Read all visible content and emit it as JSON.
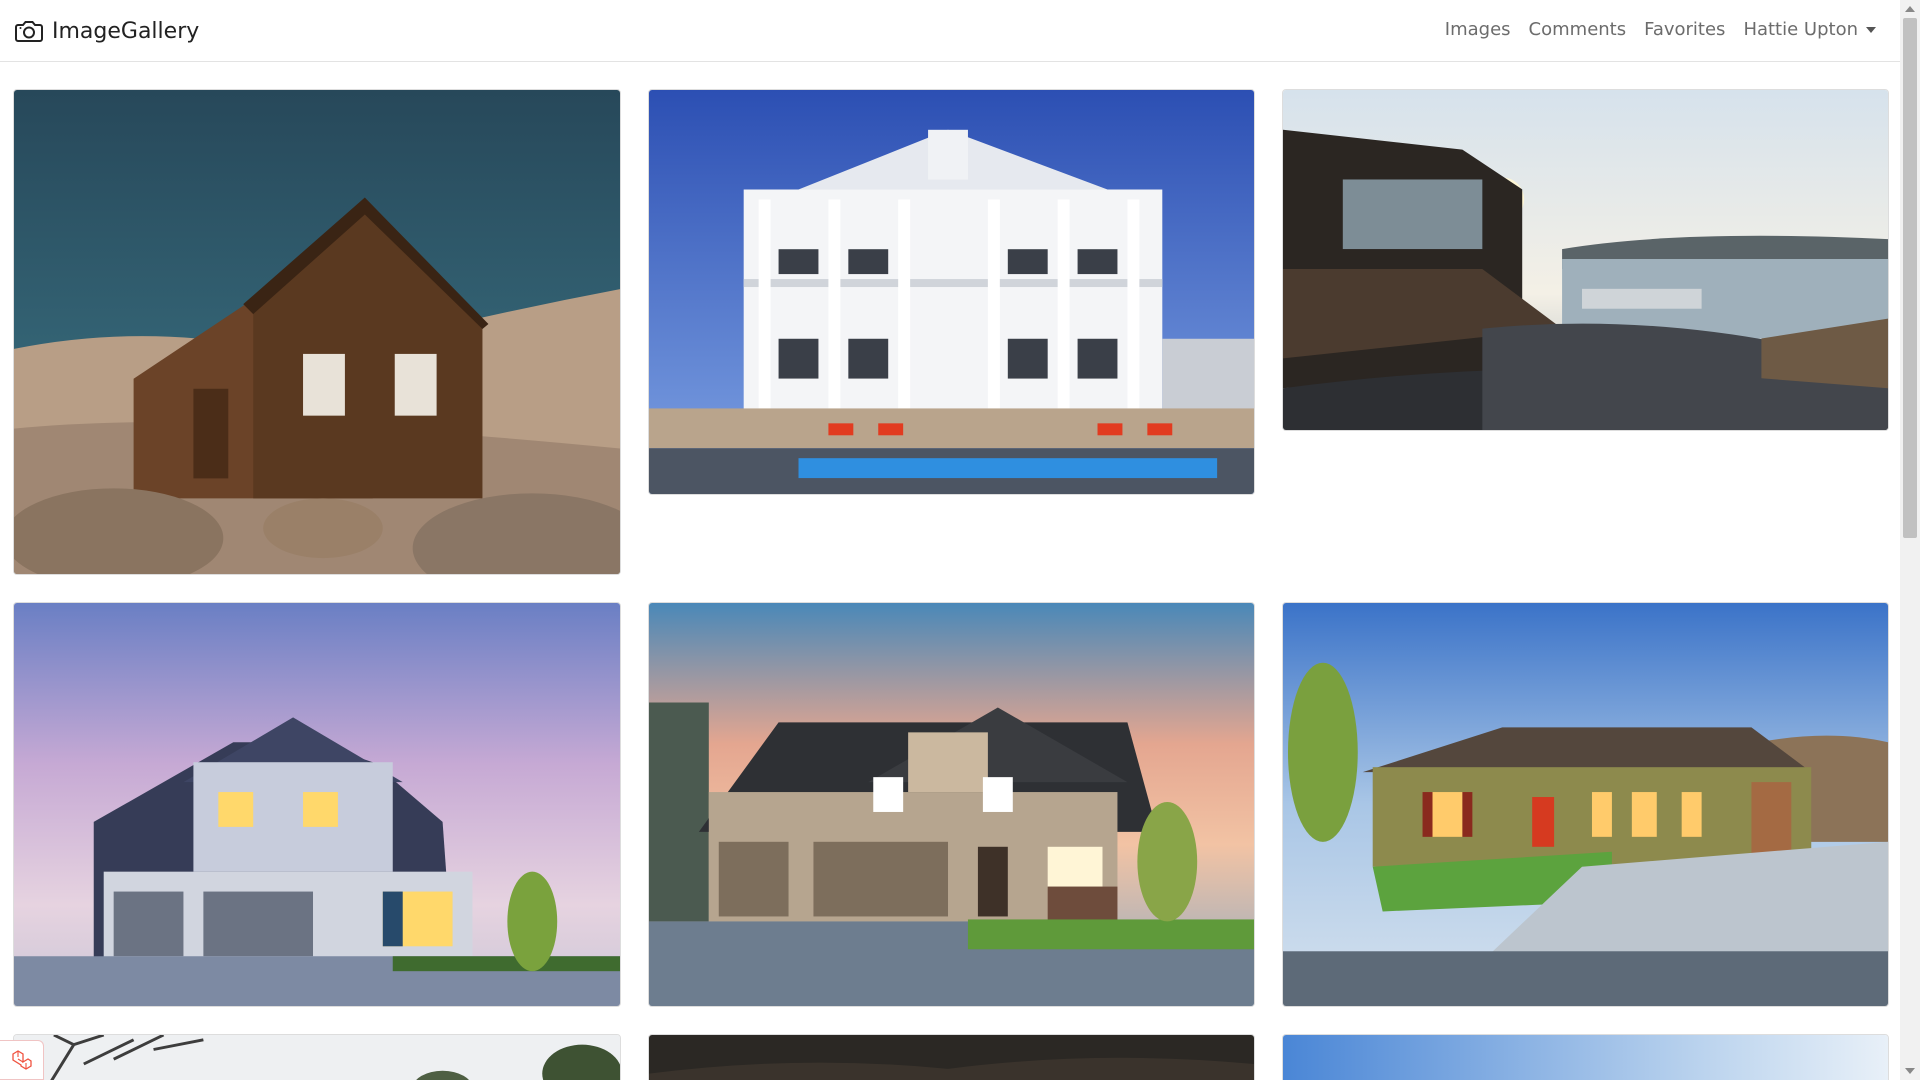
{
  "brand": {
    "name": "ImageGallery",
    "icon": "camera-icon"
  },
  "nav": {
    "images": "Images",
    "comments": "Comments",
    "favorites": "Favorites",
    "user": "Hattie Upton"
  },
  "gallery": {
    "items": [
      {
        "subject": "wooden-cabin"
      },
      {
        "subject": "white-plantation-house"
      },
      {
        "subject": "modern-villa-lake"
      },
      {
        "subject": "blue-suburban-house"
      },
      {
        "subject": "beige-house-sunset"
      },
      {
        "subject": "olive-stucco-house"
      },
      {
        "subject": "tree-house-partial"
      },
      {
        "subject": "dark-forest-partial"
      },
      {
        "subject": "sky-partial"
      }
    ]
  },
  "colors": {
    "brand_text": "#222222",
    "nav_link": "#6c6c6c",
    "border": "#dddddd"
  }
}
